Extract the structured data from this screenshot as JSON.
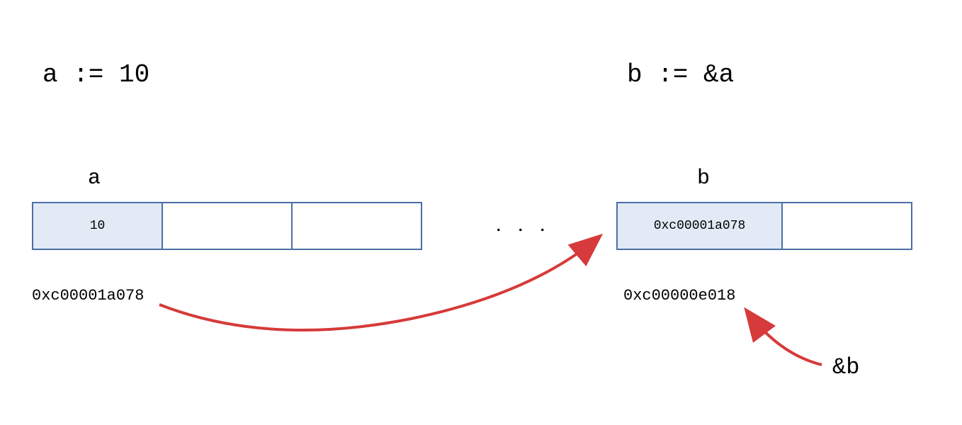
{
  "declarations": {
    "a": "a := 10",
    "b": "b := &a"
  },
  "labels": {
    "a": "a",
    "b": "b"
  },
  "cells": {
    "a_value": "10",
    "b_value": "0xc00001a078"
  },
  "addresses": {
    "a": "0xc00001a078",
    "b": "0xc00000e018"
  },
  "ellipsis": ". . .",
  "pointer_ref": "&b"
}
